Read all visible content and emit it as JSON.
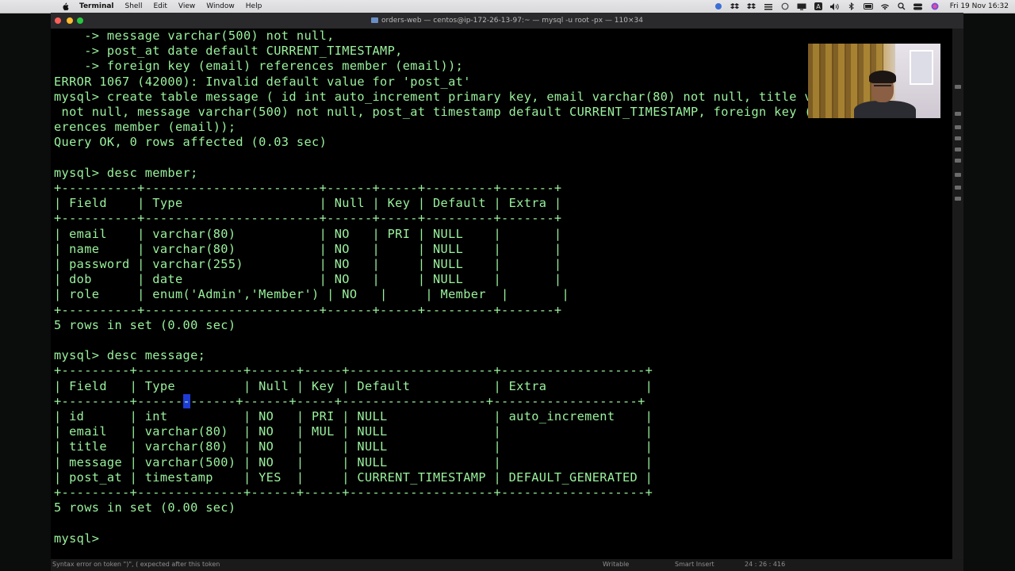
{
  "menubar": {
    "app": "Terminal",
    "items": [
      "Shell",
      "Edit",
      "View",
      "Window",
      "Help"
    ],
    "clock": "Fri 19 Nov  16:32",
    "status_icons": [
      "pin-icon",
      "dropbox-icon",
      "dropbox-icon",
      "bars-icon",
      "circle-icon",
      "display-icon",
      "input-source-icon",
      "volume-icon",
      "bluetooth-icon",
      "battery-icon",
      "wifi-icon",
      "spotlight-icon",
      "control-center-icon",
      "siri-icon"
    ]
  },
  "window": {
    "title": "orders-web — centos@ip-172-26-13-97:~ — mysql -u root -px — 110×34"
  },
  "terminal": {
    "lines": [
      "    -> message varchar(500) not null,",
      "    -> post_at date default CURRENT_TIMESTAMP,",
      "    -> foreign key (email) references member (email));",
      "ERROR 1067 (42000): Invalid default value for 'post_at'",
      "mysql> create table message ( id int auto_increment primary key, email varchar(80) not null, title varchar(80)",
      " not null, message varchar(500) not null, post_at timestamp default CURRENT_TIMESTAMP, foreign key (email) ref",
      "erences member (email));",
      "Query OK, 0 rows affected (0.03 sec)",
      "",
      "mysql> desc member;",
      "+----------+-----------------------+------+-----+---------+-------+",
      "| Field    | Type                  | Null | Key | Default | Extra |",
      "+----------+-----------------------+------+-----+---------+-------+",
      "| email    | varchar(80)           | NO   | PRI | NULL    |       |",
      "| name     | varchar(80)           | NO   |     | NULL    |       |",
      "| password | varchar(255)          | NO   |     | NULL    |       |",
      "| dob      | date                  | NO   |     | NULL    |       |",
      "| role     | enum('Admin','Member') | NO   |     | Member  |       |",
      "+----------+-----------------------+------+-----+---------+-------+",
      "5 rows in set (0.00 sec)",
      "",
      "mysql> desc message;",
      "+---------+--------------+------+-----+-------------------+-------------------+",
      "| Field   | Type         | Null | Key | Default           | Extra             |",
      "+---------+------",
      "| id      | int          | NO   | PRI | NULL              | auto_increment    |",
      "| email   | varchar(80)  | NO   | MUL | NULL              |                   |",
      "| title   | varchar(80)  | NO   |     | NULL              |                   |",
      "| message | varchar(500) | NO   |     | NULL              |                   |",
      "| post_at | timestamp    | YES  |     | CURRENT_TIMESTAMP | DEFAULT_GENERATED |",
      "+---------+--------------+------+-----+-------------------+-------------------+",
      "5 rows in set (0.00 sec)",
      "",
      "mysql> "
    ],
    "cursor_line_rest": "------+------+-----+-------------------+-------------------+",
    "cursor_char": "-"
  },
  "statusbar": {
    "message": "Syntax error on token \")\", ( expected after this token",
    "mode": "Writable",
    "insert": "Smart Insert",
    "position": "24 : 26 : 416"
  }
}
